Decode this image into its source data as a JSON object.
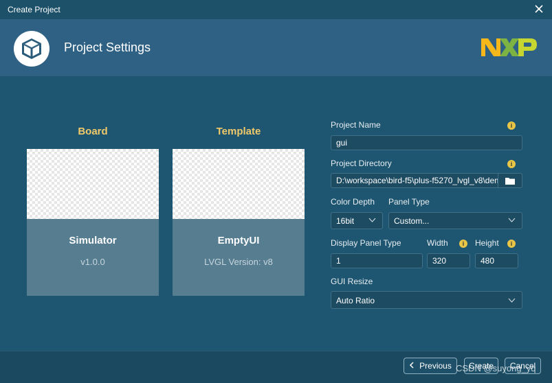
{
  "window": {
    "title": "Create Project"
  },
  "header": {
    "title": "Project Settings",
    "brand": "NXP"
  },
  "board": {
    "heading": "Board",
    "name": "Simulator",
    "version": "v1.0.0"
  },
  "template": {
    "heading": "Template",
    "name": "EmptyUI",
    "version": "LVGL Version: v8"
  },
  "form": {
    "project_name": {
      "label": "Project Name",
      "value": "gui"
    },
    "project_directory": {
      "label": "Project Directory",
      "value": "D:\\workspace\\bird-f5\\plus-f5270_lvgl_v8\\dem"
    },
    "color_depth": {
      "label": "Color Depth",
      "value": "16bit"
    },
    "panel_type": {
      "label": "Panel Type",
      "value": "Custom..."
    },
    "display_panel_type": {
      "label": "Display Panel Type",
      "value": "1"
    },
    "width": {
      "label": "Width",
      "value": "320"
    },
    "height": {
      "label": "Height",
      "value": "480"
    },
    "gui_resize": {
      "label": "GUI Resize",
      "value": "Auto Ratio"
    }
  },
  "buttons": {
    "previous": "Previous",
    "create": "Create",
    "cancel": "Cancel"
  },
  "watermark": "CSDN @suyong_yq",
  "colors": {
    "accent_gold": "#f0c96a",
    "info_yellow": "#e8c547",
    "header_bg": "#2f6184",
    "body_bg": "#1e5570"
  },
  "icons": {
    "app_logo": "cube-icon",
    "close": "close-icon",
    "info": "info-icon",
    "folder": "folder-icon",
    "dropdown": "chevron-down-icon",
    "previous": "chevron-left-icon"
  }
}
